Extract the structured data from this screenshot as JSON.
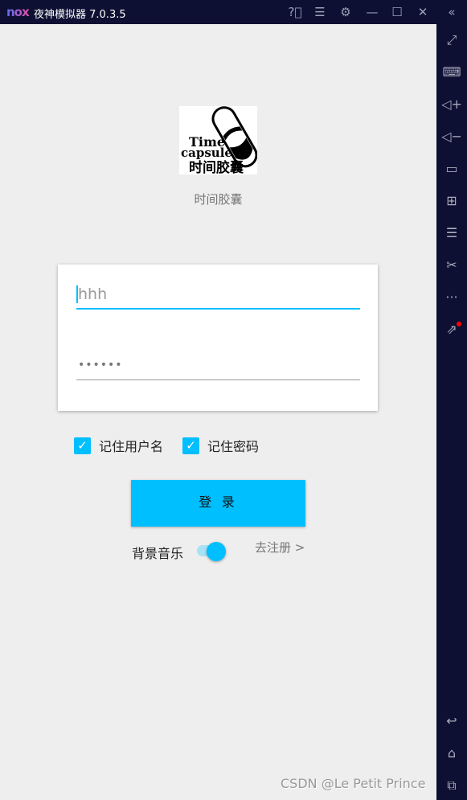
{
  "titlebar": {
    "logo": "nox",
    "title": "夜神模拟器 7.0.3.5",
    "icons": [
      "help-icon",
      "menu-icon",
      "gear-icon",
      "minimize-icon",
      "maximize-icon",
      "close-icon",
      "collapse-icon"
    ]
  },
  "sidebar": {
    "icons": [
      "fullscreen-icon",
      "keyboard-icon",
      "volume-up-icon",
      "volume-down-icon",
      "screen-icon",
      "apk-install-icon",
      "multi-instance-icon",
      "screenshot-scissors-icon",
      "more-icon",
      "share-icon",
      "back-icon",
      "home-icon",
      "recent-apps-icon"
    ],
    "badge_color": "#ff0000"
  },
  "app": {
    "logo_text": "Time capsule 时间胶囊",
    "name": "时间胶囊",
    "username_value": "hhh",
    "password_value": "••••••",
    "remember_username": {
      "label": "记住用户名",
      "checked": true
    },
    "remember_password": {
      "label": "记住密码",
      "checked": true
    },
    "login_label": "登 录",
    "music_label": "背景音乐",
    "music_on": true,
    "register_link": "去注册 >",
    "accent": "#00bfff"
  },
  "watermark": "CSDN @Le Petit Prince"
}
